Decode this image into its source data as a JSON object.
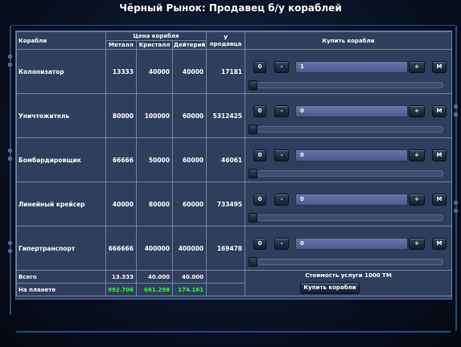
{
  "title": "Чёрный Рынок: Продавец б/у кораблей",
  "headers": {
    "ships": "Корабли",
    "price_group": "Цена корабля",
    "metal": "Металл",
    "crystal": "Кристалл",
    "deuterium": "Дейтерий",
    "on_sale": "У продавца",
    "buy": "Купить корабли"
  },
  "ships": [
    {
      "name": "Колонизатор",
      "metal": "13333",
      "crystal": "40000",
      "deuterium": "40000",
      "available": "17181",
      "quantity": "1"
    },
    {
      "name": "Уничтожитель",
      "metal": "80000",
      "crystal": "100000",
      "deuterium": "60000",
      "available": "5312425",
      "quantity": "0"
    },
    {
      "name": "Бомбардировщик",
      "metal": "66666",
      "crystal": "50000",
      "deuterium": "60000",
      "available": "46061",
      "quantity": "0"
    },
    {
      "name": "Линейный крейсер",
      "metal": "40000",
      "crystal": "80000",
      "deuterium": "60000",
      "available": "733495",
      "quantity": "0"
    },
    {
      "name": "Гипертранспорт",
      "metal": "666666",
      "crystal": "400000",
      "deuterium": "400000",
      "available": "169478",
      "quantity": "0"
    }
  ],
  "controls": {
    "zero_label": "0",
    "minus_label": "-",
    "plus_label": "+",
    "max_label": "M"
  },
  "totals": {
    "label": "Всего",
    "metal": "13.333",
    "crystal": "40.000",
    "deuterium": "40.000"
  },
  "planet": {
    "label": "На планете",
    "metal": "992.706",
    "crystal": "661.298",
    "deuterium": "174.161"
  },
  "service_cost": "Стоимость услуги 1000 ТМ",
  "buy_button": "Купить корабли",
  "colors": {
    "panel": "#2e3e5c",
    "border": "#6f86ab",
    "resource_green": "#2fff2f",
    "input": "#5566a0"
  }
}
